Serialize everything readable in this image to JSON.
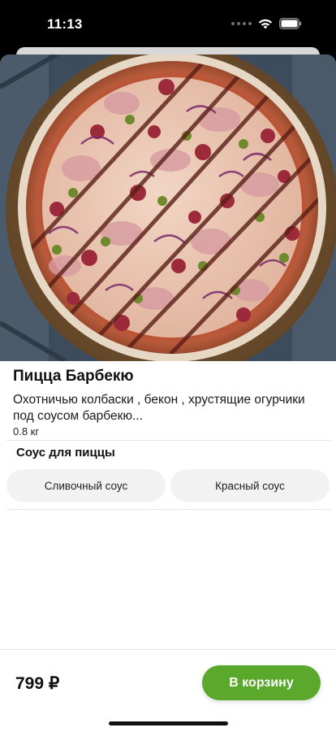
{
  "status_bar": {
    "time": "11:13"
  },
  "product": {
    "title": "Пицца Барбекю",
    "description": "Охотничью колбаски , бекон , хрустящие огурчики под соусом барбекю...",
    "weight": "0.8 кг"
  },
  "sauce": {
    "title": "Соус для пиццы",
    "options": [
      {
        "label": "Сливочный соус"
      },
      {
        "label": "Красный соус"
      }
    ]
  },
  "footer": {
    "price": "799 ₽",
    "cart_label": "В корзину",
    "accent_color": "#5aa92c"
  },
  "icons": [
    "cellular-signal-icon",
    "wifi-icon",
    "battery-icon"
  ]
}
